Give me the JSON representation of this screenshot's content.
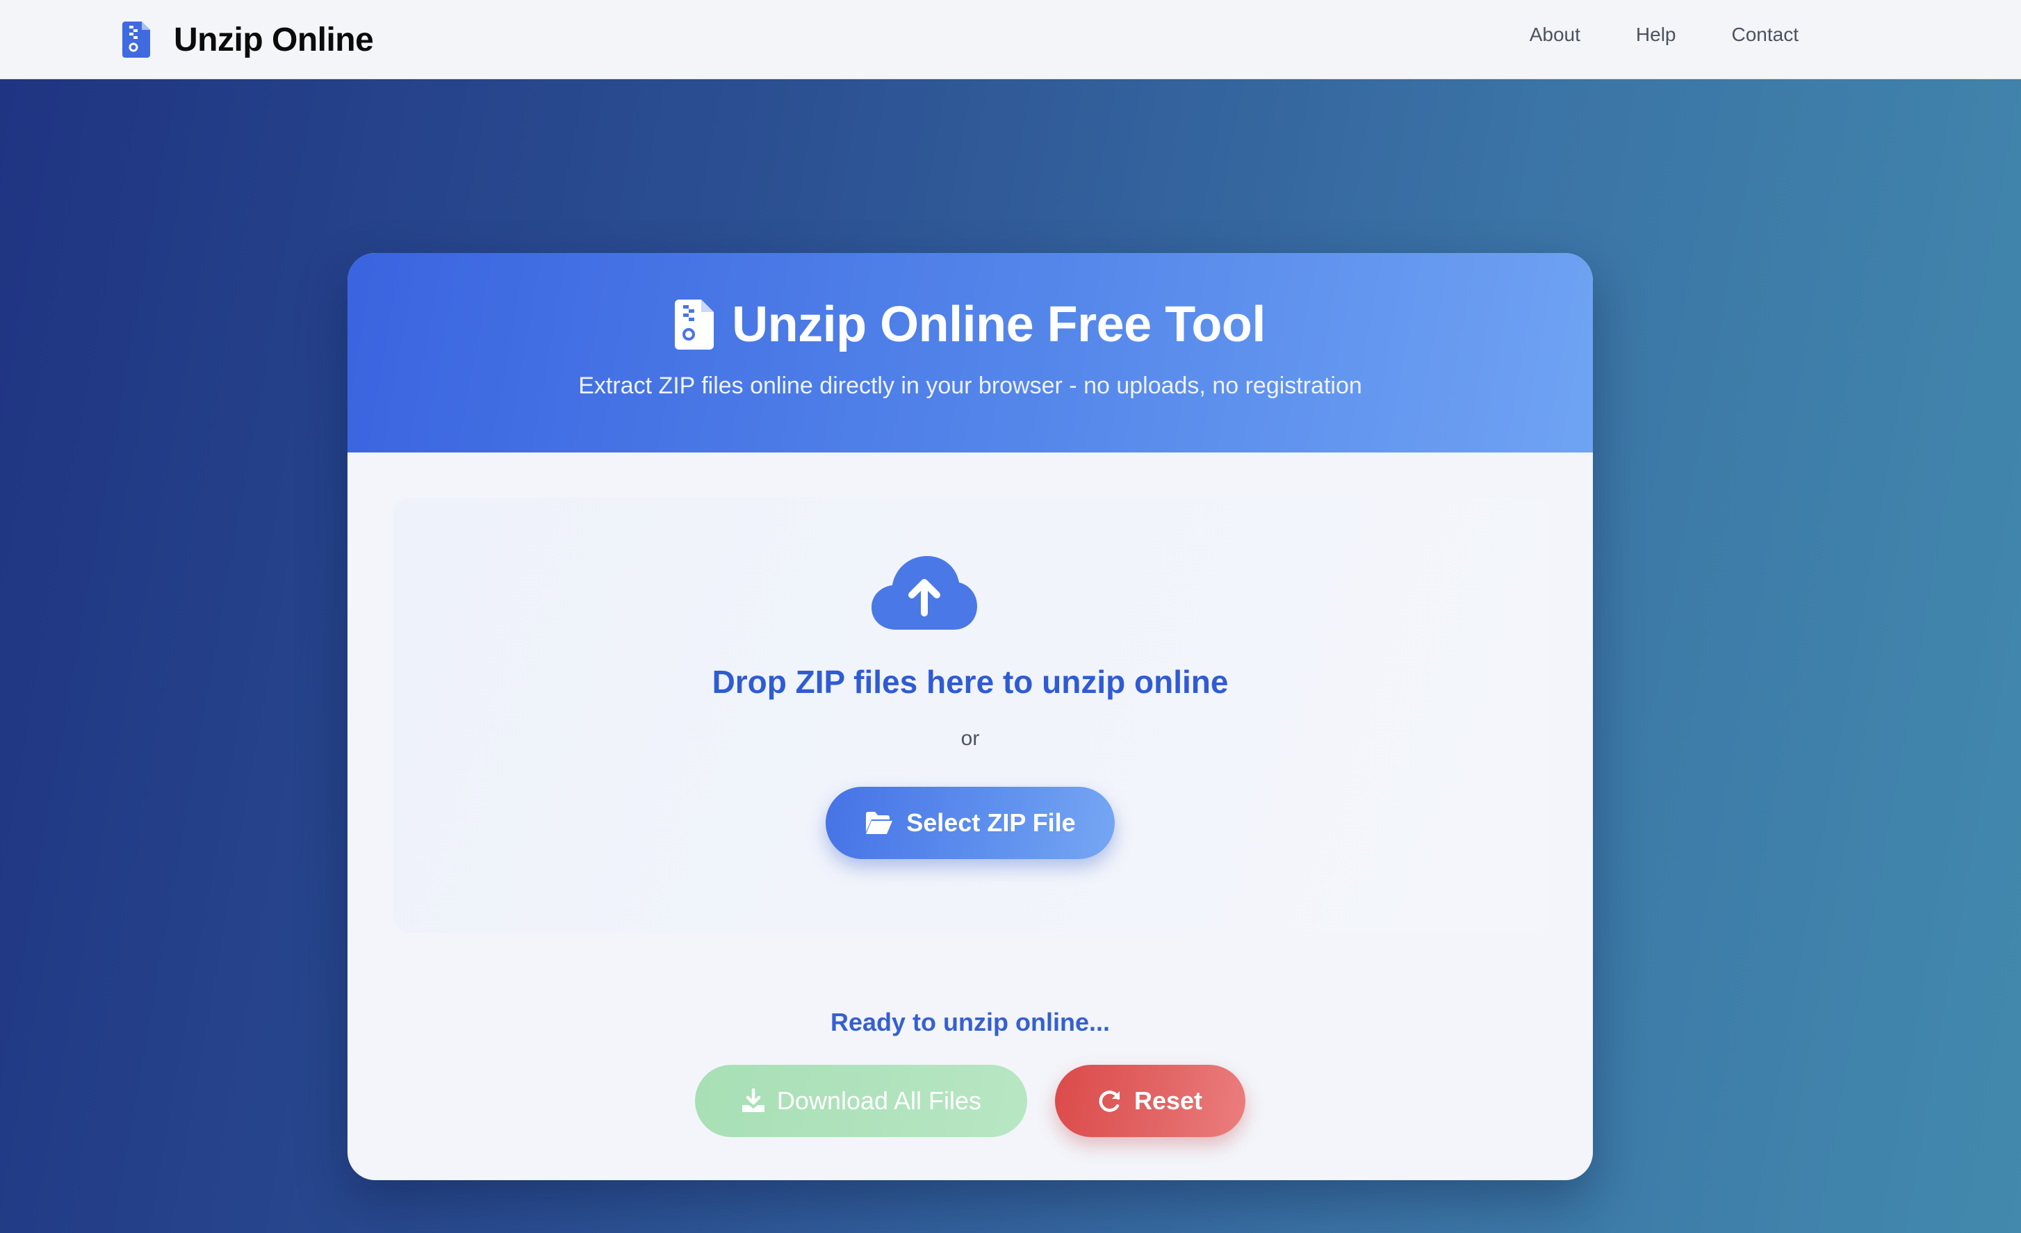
{
  "navbar": {
    "brand": "Unzip Online",
    "brand_icon": "file-zipper-icon",
    "links": [
      "About",
      "Help",
      "Contact"
    ]
  },
  "header": {
    "title": "Unzip Online Free Tool",
    "title_icon": "file-zipper-icon",
    "subtitle": "Extract ZIP files online directly in your browser - no uploads, no registration"
  },
  "dropzone": {
    "icon": "cloud-upload-icon",
    "heading": "Drop ZIP files here to unzip online",
    "or": "or",
    "select_label": "Select ZIP File",
    "select_icon": "folder-open-icon"
  },
  "status": "Ready to unzip online...",
  "actions": {
    "download_label": "Download All Files",
    "download_icon": "download-icon",
    "download_enabled": false,
    "reset_label": "Reset",
    "reset_icon": "rotate-icon"
  },
  "colors": {
    "accent": "#3a64e0",
    "heading_blue": "#2f5bd3",
    "success_disabled": "#b0e2bd",
    "danger": "#dc4a4a"
  }
}
